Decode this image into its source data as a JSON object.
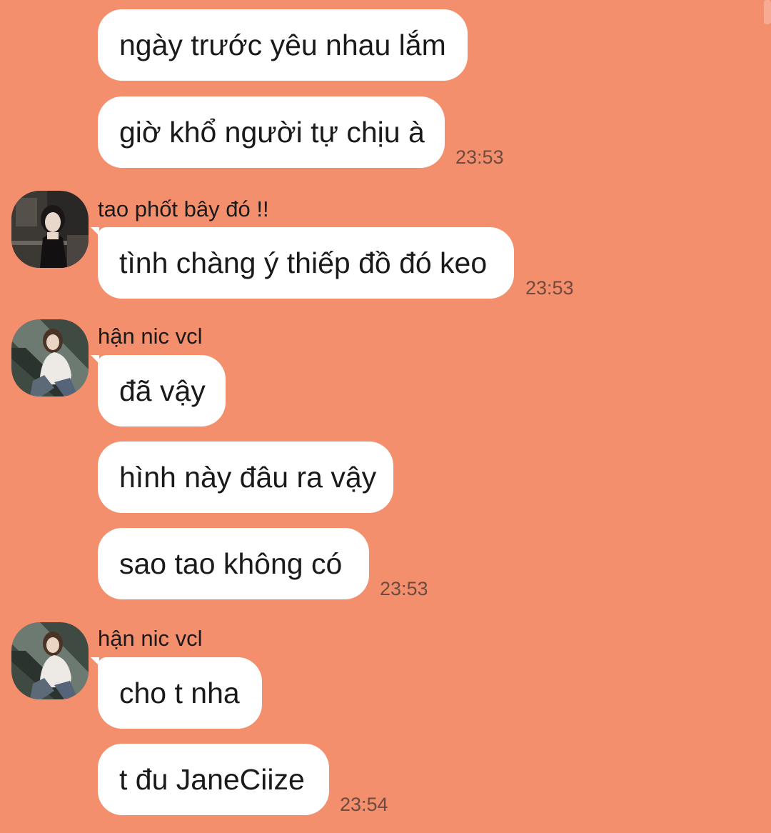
{
  "colors": {
    "background": "#F48F6E",
    "bubble": "#FFFFFF",
    "text": "#1A1A1A",
    "timestamp": "#6E4A3F"
  },
  "messages": [
    {
      "text": "ngày trước yêu nhau lắm"
    },
    {
      "text": "giờ khổ người tự chịu à",
      "time": "23:53"
    },
    {
      "sender": "tao phốt bây đó !!",
      "avatar": "avatar-dark-photo-icon",
      "text": "tình chàng ý thiếp đồ đó keo",
      "time": "23:53"
    },
    {
      "sender": "hận nic vcl",
      "avatar": "avatar-escalator-photo-icon",
      "text": "đã vậy"
    },
    {
      "text": "hình này đâu ra vậy"
    },
    {
      "text": "sao tao không có",
      "time": "23:53"
    },
    {
      "sender": "hận nic vcl",
      "avatar": "avatar-escalator-photo-icon",
      "text": "cho t nha"
    },
    {
      "text": "t đu JaneCiize",
      "time": "23:54"
    }
  ]
}
